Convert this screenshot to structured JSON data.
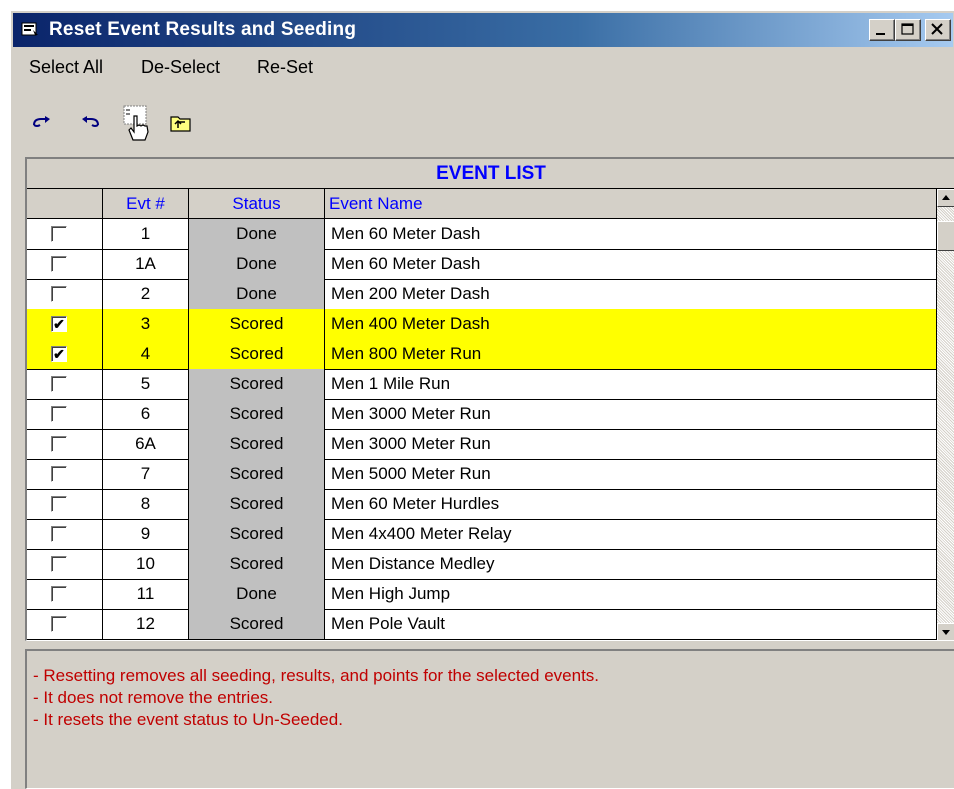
{
  "window": {
    "title": "Reset Event Results and Seeding",
    "controls": [
      "minimize",
      "maximize",
      "close"
    ]
  },
  "menu": {
    "items": [
      "Select All",
      "De-Select",
      "Re-Set"
    ]
  },
  "toolbar": {
    "icons": [
      "redo-icon",
      "undo-icon",
      "select-hand-icon",
      "folder-up-icon"
    ]
  },
  "grid": {
    "caption": "EVENT LIST",
    "headers": {
      "check": "",
      "evt": "Evt #",
      "status": "Status",
      "name": "Event Name"
    },
    "rows": [
      {
        "checked": false,
        "evt": "1",
        "status": "Done",
        "name": "Men 60 Meter Dash"
      },
      {
        "checked": false,
        "evt": "1A",
        "status": "Done",
        "name": "Men 60 Meter Dash"
      },
      {
        "checked": false,
        "evt": "2",
        "status": "Done",
        "name": "Men 200 Meter Dash"
      },
      {
        "checked": true,
        "evt": "3",
        "status": "Scored",
        "name": "Men 400 Meter Dash"
      },
      {
        "checked": true,
        "evt": "4",
        "status": "Scored",
        "name": "Men 800 Meter Run"
      },
      {
        "checked": false,
        "evt": "5",
        "status": "Scored",
        "name": "Men 1 Mile Run"
      },
      {
        "checked": false,
        "evt": "6",
        "status": "Scored",
        "name": "Men 3000 Meter Run"
      },
      {
        "checked": false,
        "evt": "6A",
        "status": "Scored",
        "name": "Men 3000 Meter Run"
      },
      {
        "checked": false,
        "evt": "7",
        "status": "Scored",
        "name": "Men 5000 Meter Run"
      },
      {
        "checked": false,
        "evt": "8",
        "status": "Scored",
        "name": "Men 60 Meter Hurdles"
      },
      {
        "checked": false,
        "evt": "9",
        "status": "Scored",
        "name": "Men 4x400 Meter Relay"
      },
      {
        "checked": false,
        "evt": "10",
        "status": "Scored",
        "name": "Men Distance Medley"
      },
      {
        "checked": false,
        "evt": "11",
        "status": "Done",
        "name": "Men High Jump"
      },
      {
        "checked": false,
        "evt": "12",
        "status": "Scored",
        "name": "Men Pole Vault"
      }
    ],
    "selected_color": "#ffff00"
  },
  "notes": [
    "- Resetting removes all seeding, results, and points for the selected events.",
    "- It does not remove the entries.",
    "- It resets the event status to Un-Seeded."
  ]
}
